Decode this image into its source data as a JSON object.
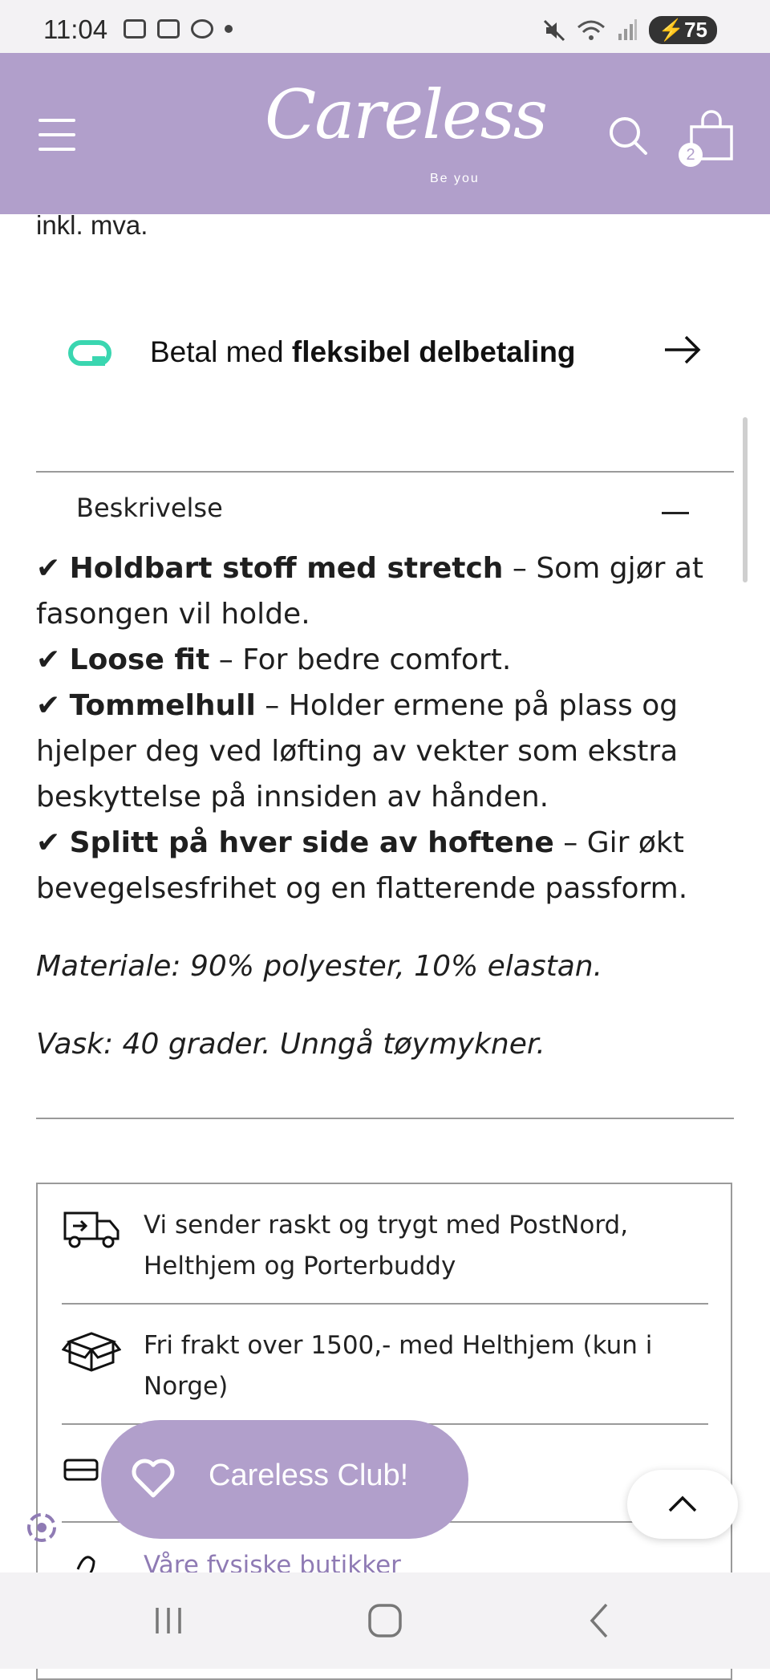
{
  "status_bar": {
    "time": "11:04",
    "battery": "75"
  },
  "header": {
    "logo_text": "Careless",
    "logo_tagline": "Be you",
    "cart_count": "2",
    "brand_color": "#b19fcb"
  },
  "price_note": "inkl. mva.",
  "payment": {
    "prefix": "Betal med ",
    "bold": "fleksibel delbetaling",
    "logo_color": "#3ad6b0"
  },
  "description": {
    "title": "Beskrivelse",
    "items": [
      {
        "check": "✔",
        "bold": "Holdbart stoff med stretch",
        "text": " – Som gjør at fasongen vil holde."
      },
      {
        "check": "✔",
        "bold": "Loose fit",
        "text": " – For bedre comfort."
      },
      {
        "check": "✔",
        "bold": "Tommelhull",
        "text": " – Holder ermene på plass og hjelper deg ved løfting av vekter som ekstra beskyttelse på innsiden av hånden."
      },
      {
        "check": "✔",
        "bold": "Splitt på hver side av hoftene",
        "text": " – Gir økt bevegelsesfrihet og en flatterende passform."
      }
    ],
    "material": "Materiale: 90% polyester, 10% elastan.",
    "wash": "Vask: 40 grader. Unngå tøymykner."
  },
  "info": {
    "shipping": "Vi sender raskt og trygt med PostNord, Helthjem og Porterbuddy",
    "free_shipping": "Fri frakt over 1500,- med Helthjem (kun i Norge)",
    "stores": "Våre fysiske butikker"
  },
  "club_button": "Careless Club!"
}
